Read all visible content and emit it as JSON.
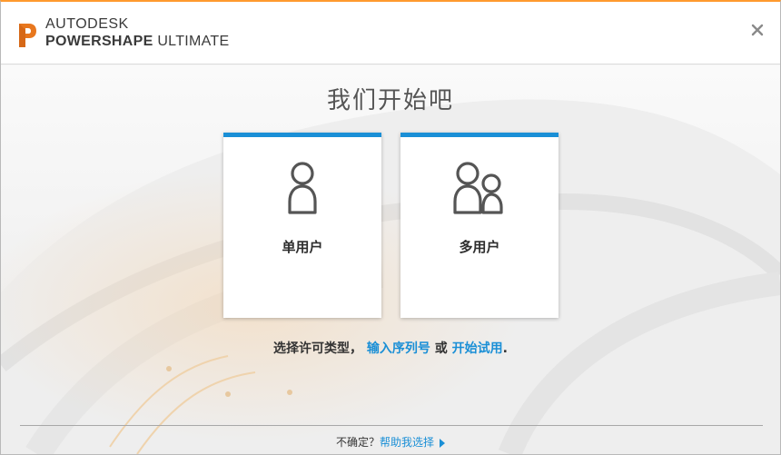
{
  "header": {
    "brand_line1": "AUTODESK",
    "brand_product_bold": "POWERSHAPE",
    "brand_product_rest": " ULTIMATE",
    "close_glyph": "×"
  },
  "main": {
    "title": "我们开始吧",
    "cards": [
      {
        "label": "单用户",
        "icon": "single-user-icon"
      },
      {
        "label": "多用户",
        "icon": "multi-user-icon"
      }
    ],
    "prompt": {
      "text": "选择许可类型，",
      "link_serial": "输入序列号",
      "or": " 或 ",
      "link_trial": "开始试用",
      "period": "."
    }
  },
  "footer": {
    "question": "不确定？",
    "help_link": "帮助我选择"
  },
  "colors": {
    "accent_blue": "#1a8fd6",
    "title_bar_orange": "#ff9a2e",
    "logo_orange": "#e8771e"
  }
}
